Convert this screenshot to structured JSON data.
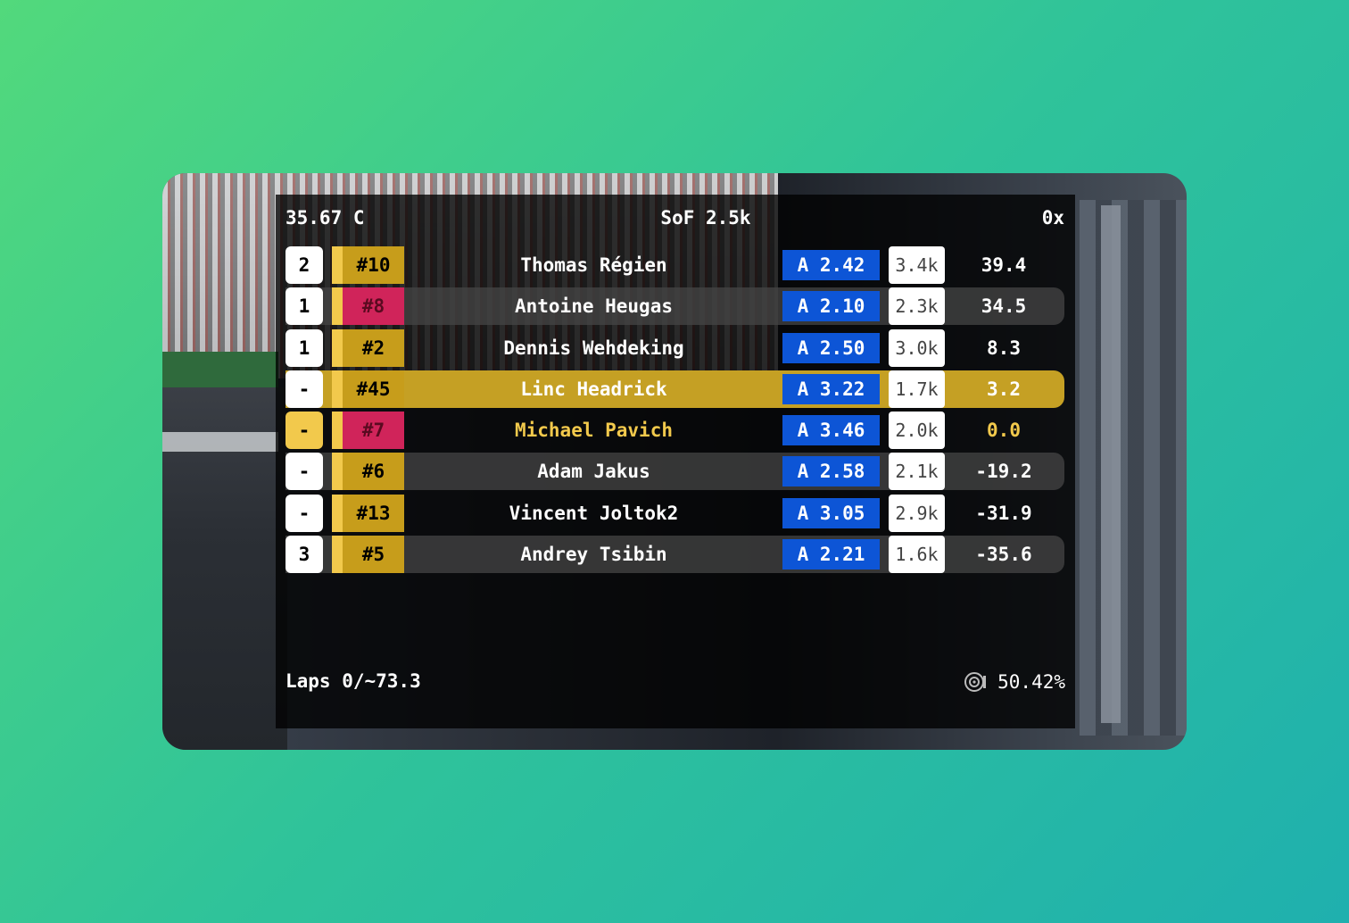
{
  "header": {
    "temperature": "35.67 C",
    "sof": "SoF 2.5k",
    "incidents": "0x"
  },
  "rows": [
    {
      "position": "2",
      "car_number": "#10",
      "driver": "Thomas Régien",
      "license": "A 2.42",
      "irating": "3.4k",
      "gap": "39.4",
      "car_color": "gold",
      "style": "plain",
      "is_player": false
    },
    {
      "position": "1",
      "car_number": "#8",
      "driver": "Antoine Heugas",
      "license": "A 2.10",
      "irating": "2.3k",
      "gap": "34.5",
      "car_color": "red",
      "style": "alt",
      "is_player": false
    },
    {
      "position": "1",
      "car_number": "#2",
      "driver": "Dennis Wehdeking",
      "license": "A 2.50",
      "irating": "3.0k",
      "gap": "8.3",
      "car_color": "gold",
      "style": "plain",
      "is_player": false
    },
    {
      "position": "-",
      "car_number": "#45",
      "driver": "Linc Headrick",
      "license": "A 3.22",
      "irating": "1.7k",
      "gap": "3.2",
      "car_color": "gold",
      "style": "highlight",
      "is_player": false
    },
    {
      "position": "-",
      "car_number": "#7",
      "driver": "Michael Pavich",
      "license": "A 3.46",
      "irating": "2.0k",
      "gap": "0.0",
      "car_color": "red",
      "style": "plain",
      "is_player": true
    },
    {
      "position": "-",
      "car_number": "#6",
      "driver": "Adam Jakus",
      "license": "A 2.58",
      "irating": "2.1k",
      "gap": "-19.2",
      "car_color": "gold",
      "style": "alt",
      "is_player": false
    },
    {
      "position": "-",
      "car_number": "#13",
      "driver": "Vincent Joltok2",
      "license": "A 3.05",
      "irating": "2.9k",
      "gap": "-31.9",
      "car_color": "gold",
      "style": "plain",
      "is_player": false
    },
    {
      "position": "3",
      "car_number": "#5",
      "driver": "Andrey Tsibin",
      "license": "A 2.21",
      "irating": "1.6k",
      "gap": "-35.6",
      "car_color": "gold",
      "style": "alt",
      "is_player": false
    }
  ],
  "footer": {
    "laps": "Laps 0/~73.3",
    "fuel_icon": "fuel-gauge-icon",
    "fuel_percent": "50.42%"
  },
  "colors": {
    "license_blue": "#0d55d6",
    "player_gold": "#f2c94c",
    "car_gold": "#c79d1b",
    "car_red": "#d0245a",
    "highlight_row": "#c5a024"
  }
}
